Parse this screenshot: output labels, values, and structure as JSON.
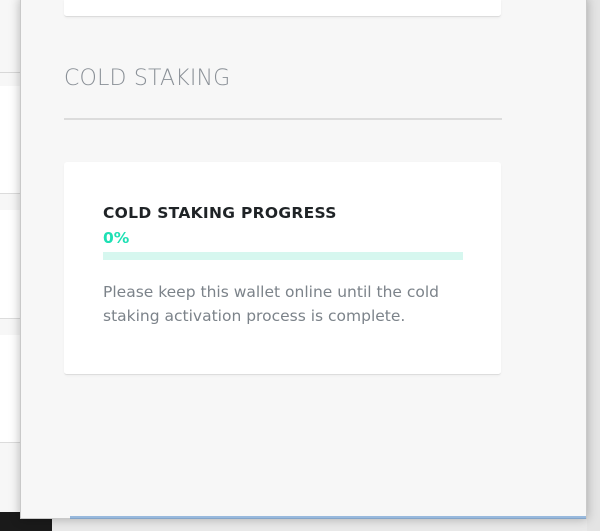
{
  "section": {
    "title": "COLD STAKING"
  },
  "progress_card": {
    "heading": "COLD STAKING PROGRESS",
    "percent_label": "0%",
    "progress_fraction": 0.0,
    "note": "Please keep this wallet online until the cold staking activation process is complete."
  },
  "colors": {
    "accent": "#1ee0b4",
    "track": "#d6f7ef",
    "title_text": "#8a9097",
    "body_text": "#7c838a"
  }
}
